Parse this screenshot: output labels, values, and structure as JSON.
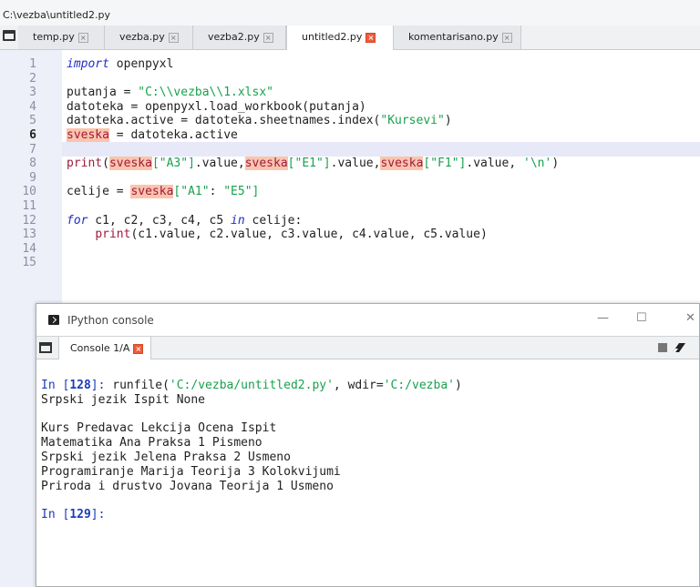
{
  "path_bar": {
    "path": "C:\\vezba\\untitled2.py"
  },
  "editor_tabs": [
    {
      "label": "temp.py"
    },
    {
      "label": "vezba.py"
    },
    {
      "label": "vezba2.py"
    },
    {
      "label": "untitled2.py"
    },
    {
      "label": "komentarisano.py"
    }
  ],
  "close_glyph": "×",
  "editor": {
    "line_numbers": [
      "1",
      "2",
      "3",
      "4",
      "5",
      "6",
      "7",
      "8",
      "9",
      "10",
      "11",
      "12",
      "13",
      "14",
      "15"
    ],
    "current_line": "6",
    "tokens": {
      "import_kw": "import",
      "line1_rest": " openpyxl",
      "line3_a": "putanja = ",
      "line3_str": "\"C:\\\\vezba\\\\1.xlsx\"",
      "line4": "datoteka = openpyxl.load_workbook(putanja)",
      "line5_a": "datoteka.active = datoteka.sheetnames.index(",
      "line5_str": "\"Kursevi\"",
      "line5_b": ")",
      "sveska": "sveska",
      "line6_rest": " = datoteka.active",
      "print_fn": "print",
      "paren_open": "(",
      "str_a3": "[\"A3\"]",
      "value_comma": ".value,",
      "str_e1": "[\"E1\"]",
      "str_f1": "[\"F1\"]",
      "value_tail": ".value, ",
      "str_newline": "'\\n'",
      "paren_close": ")",
      "line10_a": "celije = ",
      "line10_str_a": "[\"A1\"",
      "line10_colon": ": ",
      "line10_str_b": "\"E5\"]",
      "for_kw": "for",
      "line12_mid": " c1, c2, c3, c4, c5 ",
      "in_kw": "in",
      "line12_end": " celije:",
      "line13_indent": "    ",
      "line13_rest": "(c1.value, c2.value, c3.value, c4.value, c5.value)"
    }
  },
  "console": {
    "window_title": "IPython console",
    "minimize_glyph": "—",
    "maximize_glyph": "☐",
    "close_glyph": "✕",
    "tab_label": "Console 1/A",
    "prompt_in1": "In [",
    "prompt_num1": "128",
    "prompt_end1": "]: ",
    "command_a": "runfile(",
    "command_str1": "'C:/vezba/untitled2.py'",
    "command_b": ", wdir=",
    "command_str2": "'C:/vezba'",
    "command_c": ")",
    "output_lines": [
      "Srpski jezik Ispit None",
      "",
      "Kurs Predavac Lekcija Ocena Ispit",
      "Matematika Ana Praksa 1 Pismeno",
      "Srpski jezik Jelena Praksa 2 Usmeno",
      "Programiranje Marija Teorija 3 Kolokvijumi",
      "Priroda i drustvo Jovana Teorija 1 Usmeno"
    ],
    "prompt_in2": "In [",
    "prompt_num2": "129",
    "prompt_end2": "]:"
  }
}
